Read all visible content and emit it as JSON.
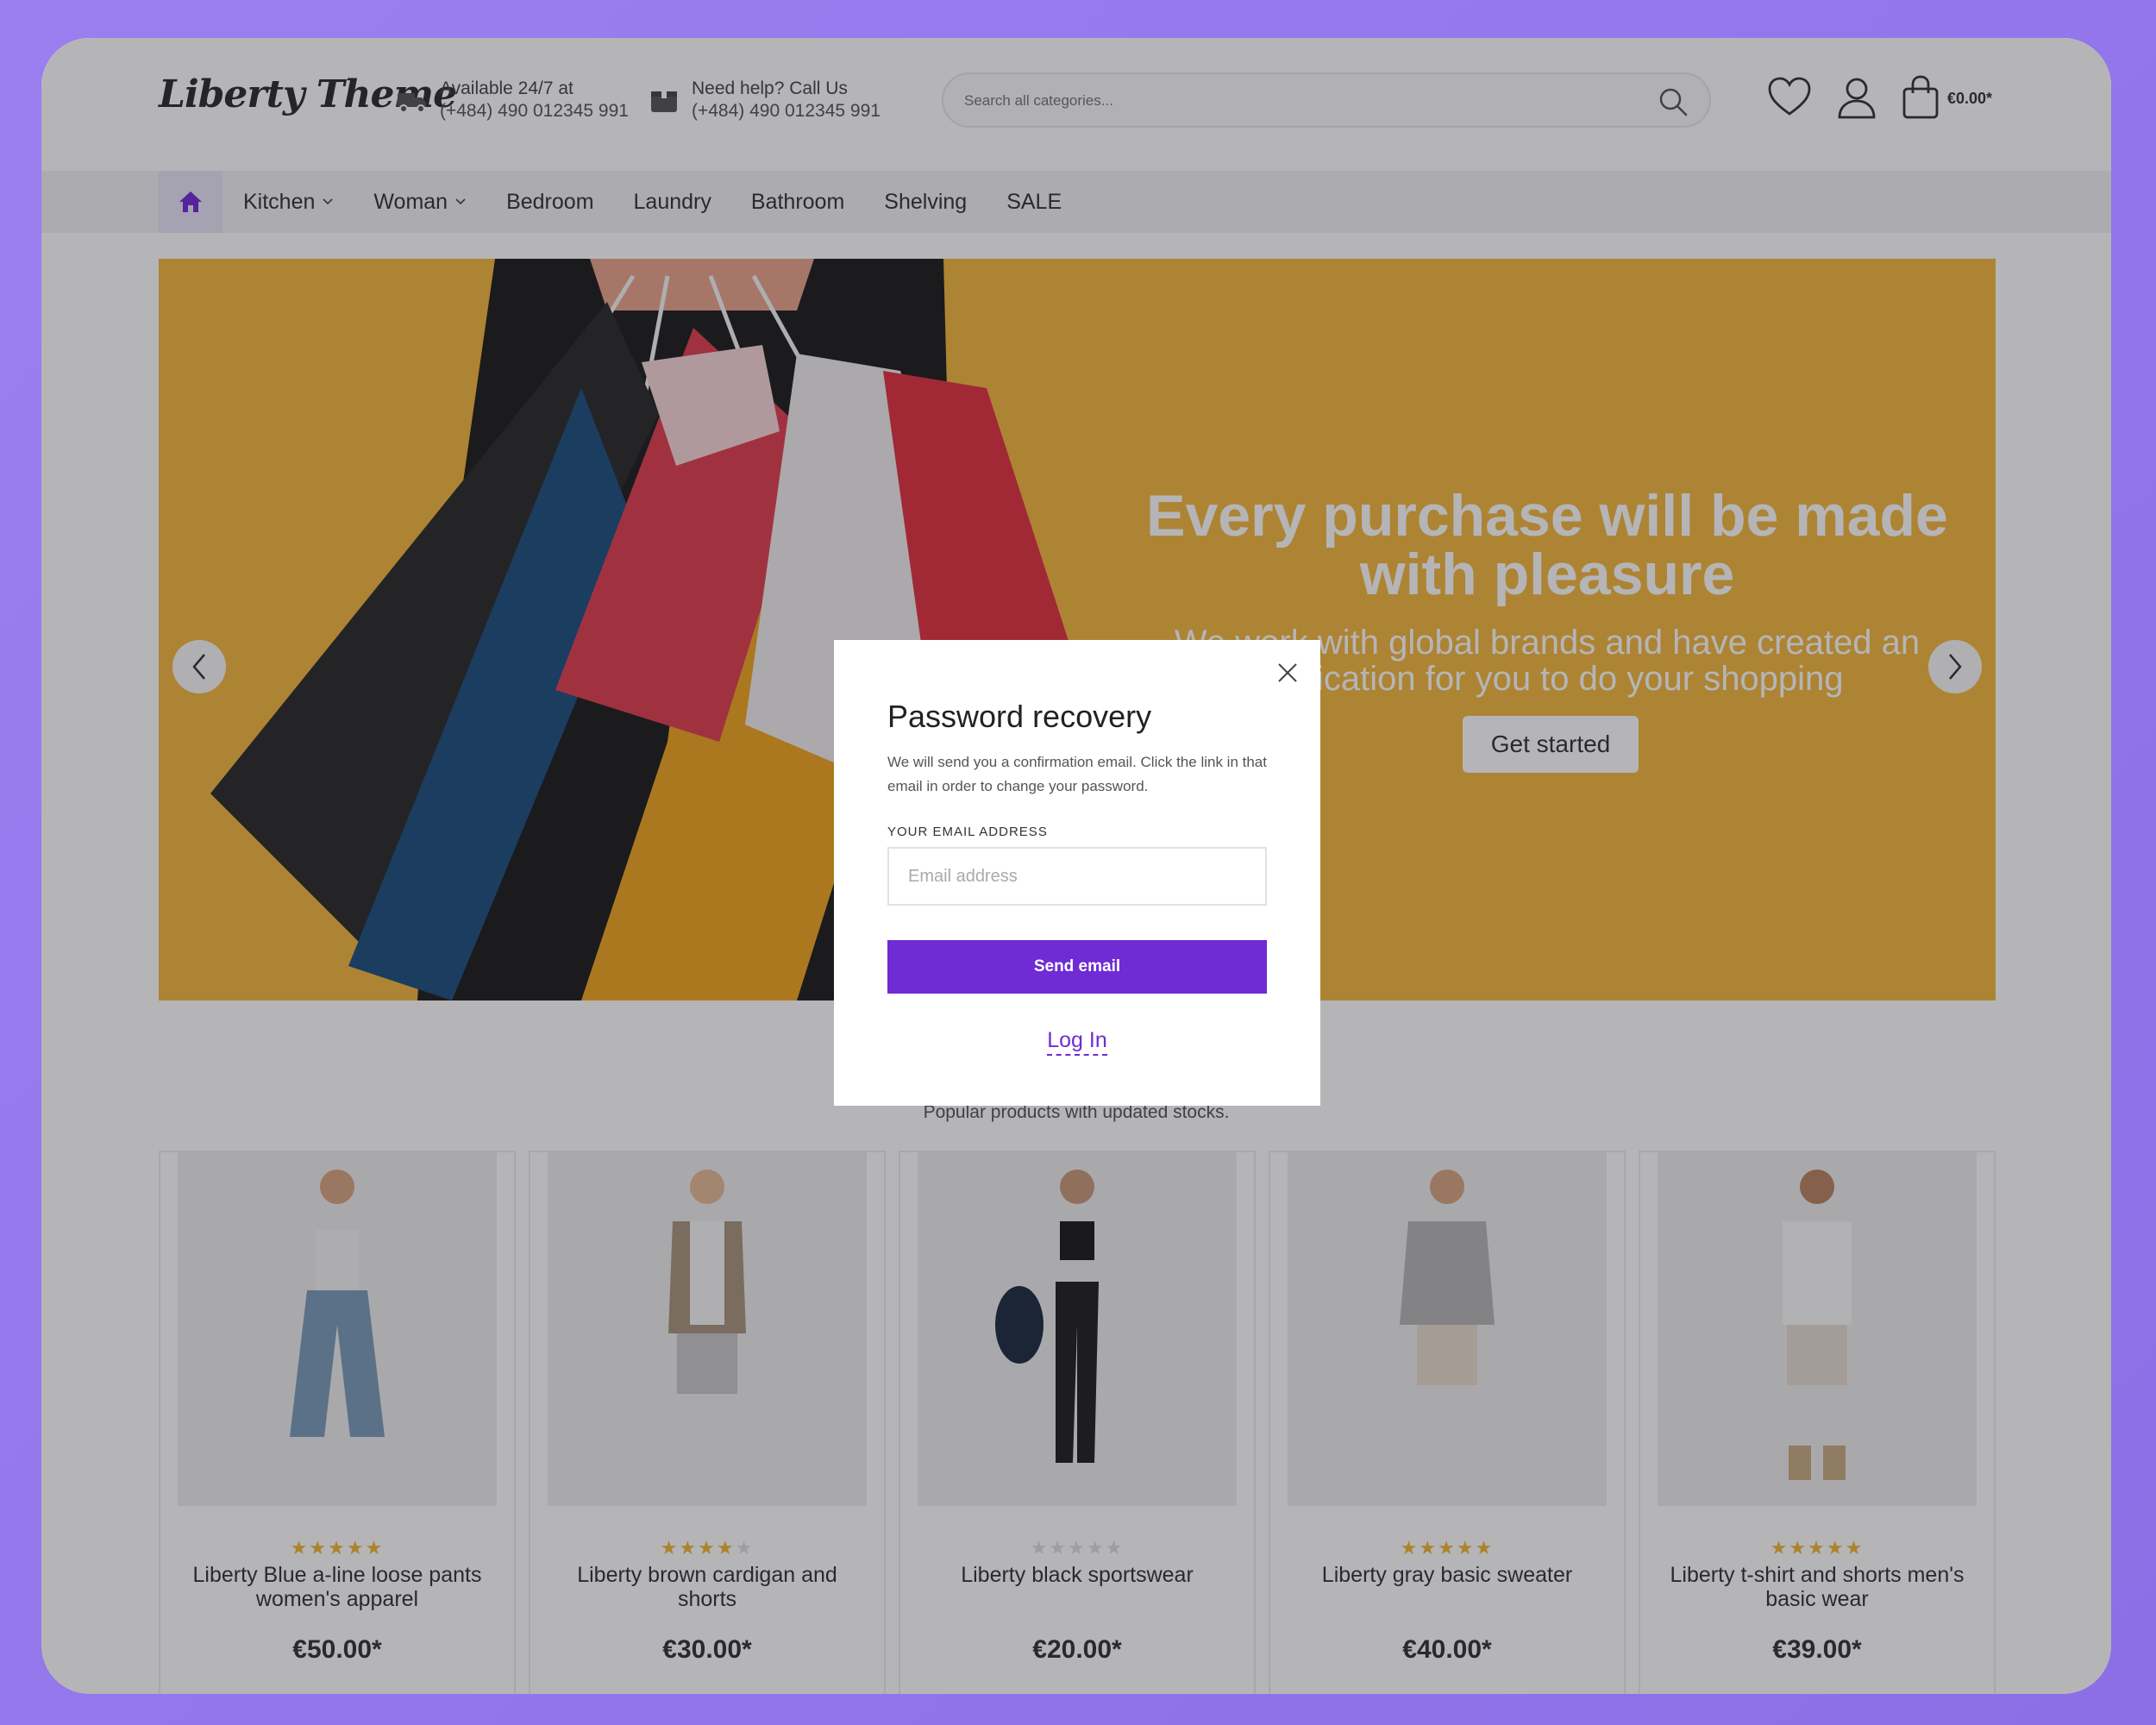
{
  "header": {
    "logo": "Liberty Theme",
    "info1": {
      "line1": "Available 24/7 at",
      "line2": "(+484) 490 012345 991"
    },
    "info2": {
      "line1": "Need help? Call Us",
      "line2": "(+484) 490 012345 991"
    },
    "search_placeholder": "Search all categories...",
    "cart_total": "€0.00*"
  },
  "nav": {
    "items": [
      "Kitchen",
      "Woman",
      "Bedroom",
      "Laundry",
      "Bathroom",
      "Shelving",
      "SALE"
    ]
  },
  "hero": {
    "title": "Every purchase will be made with pleasure",
    "subtitle": "We work with global brands and have created an application for you to do your shopping",
    "button": "Get started"
  },
  "section": {
    "subtitle": "Popular products with updated stocks."
  },
  "products": [
    {
      "name": "Liberty Blue a-line loose pants women's apparel",
      "price": "€50.00*",
      "rating": 5
    },
    {
      "name": "Liberty brown cardigan and shorts",
      "price": "€30.00*",
      "rating": 4
    },
    {
      "name": "Liberty black sportswear",
      "price": "€20.00*",
      "rating": 0
    },
    {
      "name": "Liberty gray basic sweater",
      "price": "€40.00*",
      "rating": 5
    },
    {
      "name": "Liberty t-shirt and shorts men's basic wear",
      "price": "€39.00*",
      "rating": 5
    }
  ],
  "modal": {
    "title": "Password recovery",
    "description": "We will send you a confirmation email. Click the link in that email in order to change your password.",
    "email_label": "YOUR EMAIL ADDRESS",
    "email_placeholder": "Email address",
    "email_value": "",
    "send_button": "Send email",
    "login_link": "Log In"
  },
  "colors": {
    "accent": "#6f2bd4",
    "hero_bg": "#f3b73b",
    "star": "#f2b632",
    "page_bg": "#9b7ff0"
  }
}
